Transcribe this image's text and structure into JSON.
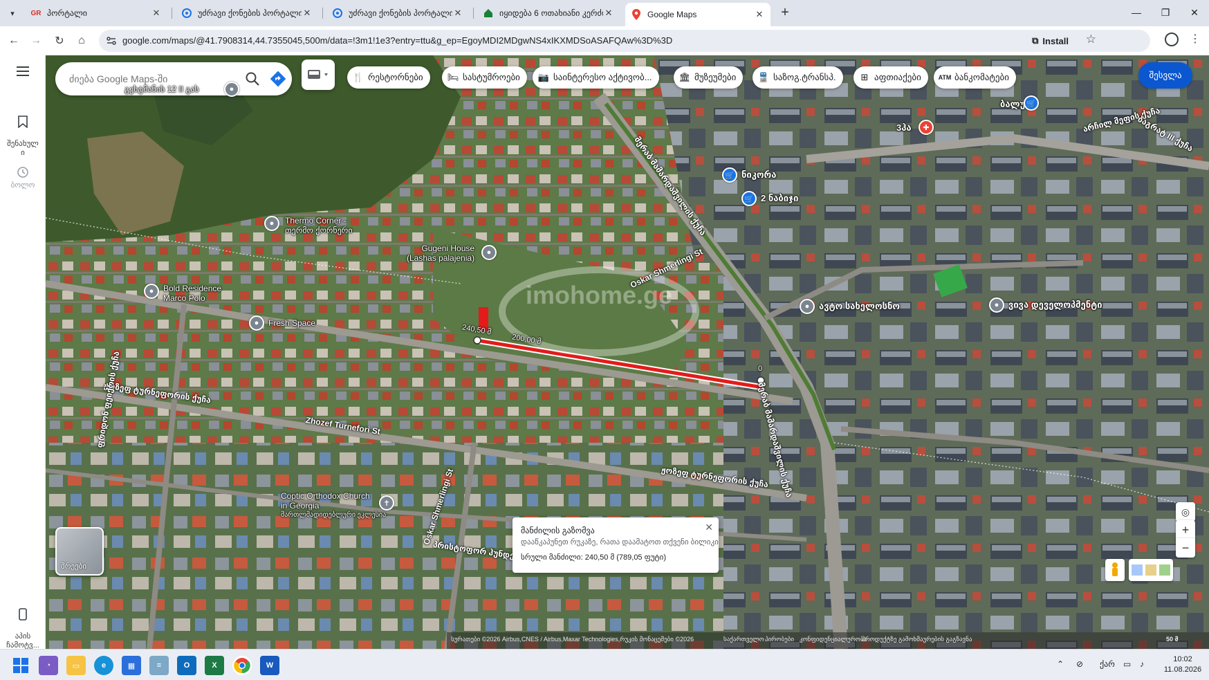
{
  "browser": {
    "tabs": [
      {
        "label": "პორტალი",
        "icon": "gr-logo-icon",
        "color": "#d93025"
      },
      {
        "label": "უძრავი ქონების პორტალი",
        "icon": "portal-icon",
        "color": "#1a73e8"
      },
      {
        "label": "უძრავი ქონების პორტალი",
        "icon": "portal-icon",
        "color": "#1a73e8"
      },
      {
        "label": "იყიდება 6 ოთახიანი კერძო",
        "icon": "house-icon",
        "color": "#188038"
      },
      {
        "label": "Google Maps",
        "icon": "maps-pin-icon",
        "color": "#ea4335"
      }
    ],
    "active_tab": 4,
    "url": "google.com/maps/@41.7908314,44.7355045,500m/data=!3m1!1e3?entry=ttu&g_ep=EgoyMDI2MDgwNS4xIKXMDSoASAFQAw%3D%3D",
    "install_label": "Install"
  },
  "maps": {
    "rail": [
      {
        "label": "შენახულ\nი",
        "icon": "bookmark-icon"
      },
      {
        "label": "ბოლო",
        "icon": "history-icon"
      },
      {
        "label": "აპის\nჩამოტვ...",
        "icon": "phone-icon"
      }
    ],
    "search_placeholder": "ძიება Google Maps-ში",
    "chips": [
      {
        "label": "რესტორნები",
        "icon": "restaurant-icon"
      },
      {
        "label": "სასტუმროები",
        "icon": "hotel-icon"
      },
      {
        "label": "საინტერესო აქტივობ...",
        "icon": "camera-icon"
      },
      {
        "label": "მუზეუმები",
        "icon": "museum-icon"
      },
      {
        "label": "საზოგ.ტრანსპ.",
        "icon": "transit-icon"
      },
      {
        "label": "აფთიაქები",
        "icon": "pharmacy-icon"
      },
      {
        "label": "ბანკომატები",
        "icon": "atm-icon"
      }
    ],
    "signin_label": "შესვლა",
    "layers_label": "შრეები",
    "places": [
      {
        "name": "გეხტმანის 12 II გას",
        "pin": "grey"
      },
      {
        "name": "Thermo Corner -\nთერმო ქორნერი",
        "pin": "grey"
      },
      {
        "name": "Gugeni House\n(Lashas palajenia)",
        "pin": "grey"
      },
      {
        "name": "Bold Residence\nMarco Polo",
        "pin": "grey"
      },
      {
        "name": "Fresh Space",
        "pin": "grey"
      },
      {
        "name": "Coptic Orthodox Church\nin Georgia",
        "pin": "grey"
      },
      {
        "name": "ნიკორა",
        "pin": "blue"
      },
      {
        "name": "2 ნაბიჯი",
        "pin": "blue"
      },
      {
        "name": "ავტო სახელოსნო",
        "pin": "grey"
      },
      {
        "name": "ვივა დეველოპმენტი",
        "pin": "grey"
      },
      {
        "name": "ბალუ",
        "pin": "blue"
      },
      {
        "name": "3ჰა",
        "pin": "red"
      }
    ],
    "church_sub": "მართლმადიდებლური ეკლესია",
    "roads": {
      "oskar": "Oskar Shmerlingi St",
      "oskar2": "Oskar Shmerlingi St",
      "turnefori": "Zhozef Turnefori St",
      "turnefori_ka": "ჟოზეფ ტურნეფორის ქუჩა",
      "turnefori_ka2": "ჟოზეფ ტურნეფორის ქუჩა",
      "merab": "მერაბ მამარდაშვილის ქუჩა",
      "archil": "არჩილ მეფის ქუჩა",
      "bagrat": "ბაგრატ III ქუჩა",
      "vertical": "მერაბ მამარდაშვილის ქუჩა",
      "vertical2": "ბერსაშ მეფის ქუჩა",
      "left": "ფრიდონ ფეიქრის ქუჩა",
      "bottom": "პრისტოფორ ჰუნდერის ქუჩა"
    },
    "measure": {
      "point_labels": [
        "240,50 მ",
        "200,00 მ",
        "0"
      ],
      "popup_title": "მანძილის გაზომვა",
      "popup_hint": "დააწკაპუნეთ რუკაზე, რათა დაამატოთ თქვენი ბილიკი",
      "popup_distance": "სრული მანძილი: 240,50 მ (789,05 ფუტი)"
    },
    "watermark": "imohome.ge",
    "attribution": {
      "imagery": "სურათები ©2026 Airbus,CNES / Airbus,Maxar Technologies,რუკის მონაცემები ©2026",
      "terms": "საქართველო",
      "privacy": "პირობები",
      "privacy2": "კონფიდენციალურობა",
      "feedback": "პროდუქტზე გამოხმაურების გაგზავნა",
      "scale": "50 მ"
    }
  },
  "taskbar": {
    "lang": "ქარ",
    "time": "10:02",
    "date": "11.08.2026",
    "apps": [
      "start-icon",
      "widgets-icon",
      "explorer-icon",
      "edge-icon",
      "store-icon",
      "notepad-icon",
      "outlook-icon",
      "excel-icon",
      "chrome-icon",
      "word-icon"
    ]
  }
}
